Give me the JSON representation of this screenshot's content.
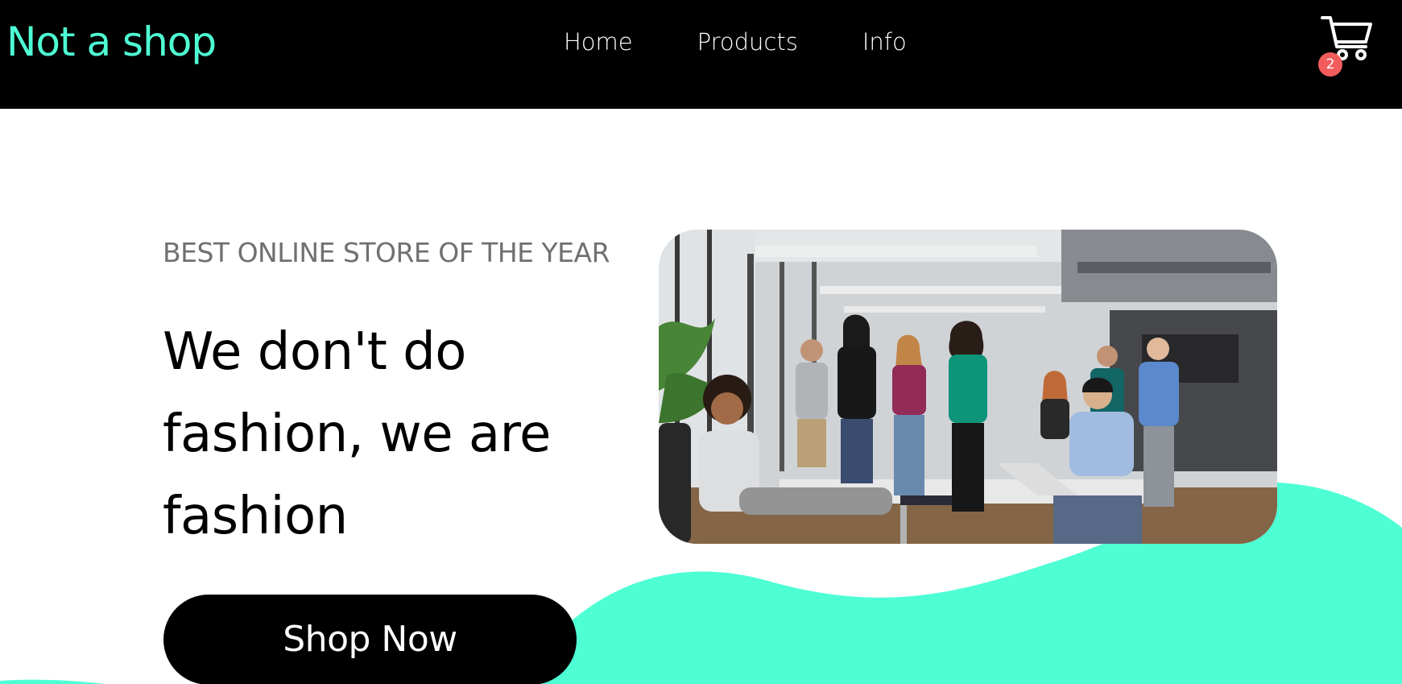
{
  "colors": {
    "accent": "#4effd4",
    "navbar_bg": "#000000",
    "badge": "#f25c5c",
    "eyebrow_text": "#707070"
  },
  "header": {
    "brand": "Not a shop",
    "nav": [
      "Home",
      "Products",
      "Info"
    ],
    "cart_icon": "shopping-cart-icon",
    "cart_count": "2"
  },
  "hero": {
    "eyebrow": "BEST ONLINE STORE OF THE YEAR",
    "headline_lines": [
      "We don't do",
      "fashion, we are",
      "fashion"
    ],
    "cta_label": "Shop Now",
    "image_description": "team-of-office-workers-photo"
  }
}
